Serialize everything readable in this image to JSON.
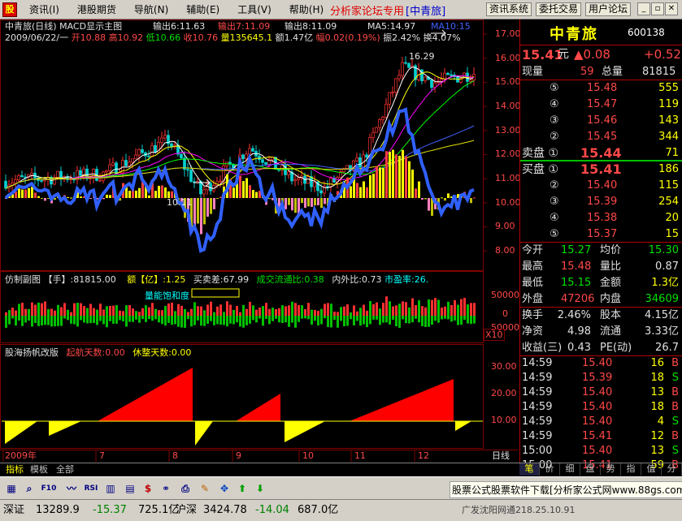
{
  "menu": {
    "items": [
      "资讯(I)",
      "港股期货",
      "导航(N)",
      "辅助(E)",
      "工具(V)",
      "帮助(H)"
    ],
    "promo": "分析家论坛专用",
    "promo_tag": "[中青旅]",
    "buttons": [
      "资讯系统",
      "委托交易",
      "用户论坛"
    ]
  },
  "main_panel": {
    "title": "中青旅(日线)",
    "indicator_name": "MACD显示主图",
    "out6": "输出6:11.63",
    "out7": "输出7:11.09",
    "out8": "输出8:11.09",
    "ma5": "MA5:14.97",
    "ma10": "MA10:15",
    "info_line_date": "2009/06/22/一",
    "info_open": "开10.88",
    "info_high": "高10.92",
    "info_low": "低10.66",
    "info_close": "收10.76",
    "info_vol": "量135645.1",
    "info_amt": "额1.47亿",
    "info_amp": "幅0.02(0.19%)",
    "info_swing": "振2.42%",
    "info_turn": "换4.07%",
    "high_label": "16.29",
    "low_label": "10.11",
    "y_ticks": [
      "17.00",
      "16.00",
      "15.00",
      "14.00",
      "13.00",
      "12.00",
      "11.00",
      "10.00",
      "9.00",
      "8.00"
    ]
  },
  "sub1": {
    "title": "仿制副图",
    "vol": "【手】:81815.00",
    "amt": "额【亿】:1.25",
    "spread": "买卖差:67.99",
    "circ_ratio": "成交流通比:0.38",
    "inout_ratio": "内外比:0.73",
    "pe": "市盈率:26.",
    "label": "量能饱和度",
    "y_ticks": [
      "50000",
      "0",
      "50000"
    ],
    "unit": "X10"
  },
  "sub2": {
    "title": "股海扬帆改版",
    "up_days": "起航天数:0.00",
    "rest_days": "休整天数:0.00",
    "y_ticks": [
      "30.00",
      "20.00",
      "10.00"
    ]
  },
  "x_axis": {
    "labels": [
      "2009年",
      "7",
      "8",
      "9",
      "10",
      "11",
      "12"
    ],
    "period": "日线"
  },
  "quote": {
    "name": "中青旅",
    "code": "600138",
    "price": "15.41",
    "price_unit": "元",
    "change_arrow": "▲0.08",
    "change": "+0.52",
    "now_vol_label": "现量",
    "now_vol": "59",
    "total_vol_label": "总量",
    "total_vol": "81815",
    "asks": [
      {
        "label": "⑤",
        "price": "15.48",
        "vol": "555"
      },
      {
        "label": "④",
        "price": "15.47",
        "vol": "119"
      },
      {
        "label": "③",
        "price": "15.46",
        "vol": "143"
      },
      {
        "label": "②",
        "price": "15.45",
        "vol": "344"
      },
      {
        "label": "卖盘 ①",
        "price": "15.44",
        "vol": "71"
      }
    ],
    "bids": [
      {
        "label": "买盘 ①",
        "price": "15.41",
        "vol": "186"
      },
      {
        "label": "②",
        "price": "15.40",
        "vol": "115"
      },
      {
        "label": "③",
        "price": "15.39",
        "vol": "254"
      },
      {
        "label": "④",
        "price": "15.38",
        "vol": "20"
      },
      {
        "label": "⑤",
        "price": "15.37",
        "vol": "15"
      }
    ],
    "stats": [
      {
        "l1": "今开",
        "v1": "15.27",
        "c1": "grn",
        "l2": "均价",
        "v2": "15.30",
        "c2": "grn"
      },
      {
        "l1": "最高",
        "v1": "15.48",
        "c1": "red",
        "l2": "量比",
        "v2": "0.87",
        "c2": "wht"
      },
      {
        "l1": "最低",
        "v1": "15.15",
        "c1": "grn",
        "l2": "金额",
        "v2": "1.3亿",
        "c2": "yel"
      },
      {
        "l1": "外盘",
        "v1": "47206",
        "c1": "red",
        "l2": "内盘",
        "v2": "34609",
        "c2": "grn"
      }
    ],
    "stats2": [
      {
        "l1": "换手",
        "v1": "2.46%",
        "l2": "股本",
        "v2": "4.15亿"
      },
      {
        "l1": "净资",
        "v1": "4.98",
        "l2": "流通",
        "v2": "3.33亿"
      },
      {
        "l1": "收益(三)",
        "v1": "0.43",
        "l2": "PE(动)",
        "v2": "26.7"
      }
    ],
    "ticks": [
      {
        "time": "14:59",
        "price": "15.40",
        "vol": "16",
        "side": "B",
        "c": "red",
        "sc": "red"
      },
      {
        "time": "14:59",
        "price": "15.39",
        "vol": "18",
        "side": "S",
        "c": "red",
        "sc": "grn"
      },
      {
        "time": "14:59",
        "price": "15.40",
        "vol": "13",
        "side": "B",
        "c": "red",
        "sc": "red"
      },
      {
        "time": "14:59",
        "price": "15.40",
        "vol": "18",
        "side": "B",
        "c": "red",
        "sc": "red"
      },
      {
        "time": "14:59",
        "price": "15.40",
        "vol": "4",
        "side": "S",
        "c": "red",
        "sc": "grn"
      },
      {
        "time": "14:59",
        "price": "15.41",
        "vol": "12",
        "side": "B",
        "c": "red",
        "sc": "red"
      },
      {
        "time": "15:00",
        "price": "15.40",
        "vol": "13",
        "side": "S",
        "c": "red",
        "sc": "grn"
      },
      {
        "time": "15:00",
        "price": "15.41",
        "vol": "59",
        "side": "B",
        "c": "red",
        "sc": "red"
      }
    ]
  },
  "tabs": [
    "指标",
    "模板",
    "全部"
  ],
  "quote_tabs": [
    "笔",
    "价",
    "细",
    "盘",
    "势",
    "指",
    "值",
    "分"
  ],
  "toolbar": {
    "advert": "股票公式股票软件下载[分析家公式网www.88gs.com]"
  },
  "status": {
    "sh_label": "深证",
    "sh_val": "13289.9",
    "sh_chg": "-15.37",
    "sh_amt": "725.1亿",
    "sz_label": "沪深",
    "sz_val": "3424.78",
    "sz_chg": "-14.04",
    "sz_amt": "687.0亿",
    "scroll_text": "广发沈阳网通218.25.10.91"
  },
  "colors": {
    "up": "#ff3232",
    "down": "#00c000",
    "bg": "#000000",
    "grid": "#800000"
  }
}
